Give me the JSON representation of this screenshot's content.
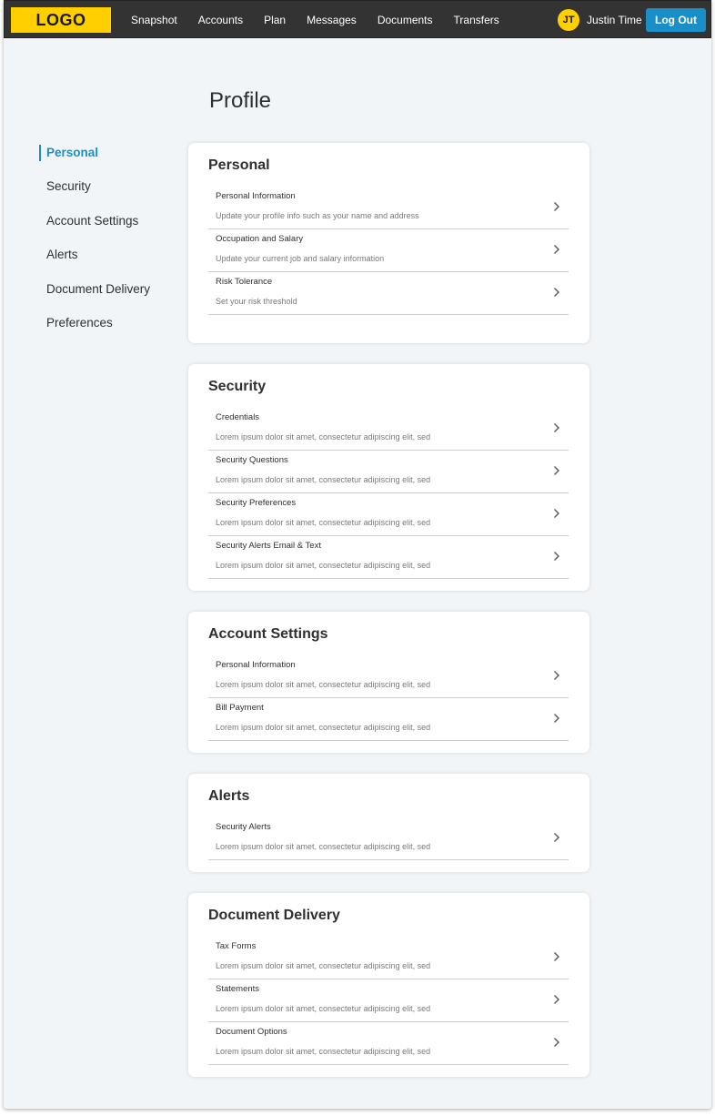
{
  "header": {
    "logo": "LOGO",
    "nav": [
      "Snapshot",
      "Accounts",
      "Plan",
      "Messages",
      "Documents",
      "Transfers"
    ],
    "user_initials": "JT",
    "user_name": "Justin Time",
    "logout_label": "Log Out"
  },
  "page_title": "Profile",
  "sidebar": {
    "items": [
      {
        "label": "Personal",
        "active": true
      },
      {
        "label": "Security"
      },
      {
        "label": "Account Settings"
      },
      {
        "label": "Alerts"
      },
      {
        "label": "Document Delivery"
      },
      {
        "label": "Preferences"
      }
    ]
  },
  "sections": [
    {
      "title": "Personal",
      "rows": [
        {
          "title": "Personal Information",
          "desc": "Update your profile info such as your name and address"
        },
        {
          "title": "Occupation and Salary",
          "desc": "Update your current job and salary information"
        },
        {
          "title": "Risk Tolerance",
          "desc": "Set your risk threshold"
        }
      ]
    },
    {
      "title": "Security",
      "rows": [
        {
          "title": "Credentials",
          "desc": "Lorem ipsum dolor sit amet, consectetur adipiscing elit, sed"
        },
        {
          "title": "Security Questions",
          "desc": "Lorem ipsum dolor sit amet, consectetur adipiscing elit, sed"
        },
        {
          "title": "Security Preferences",
          "desc": "Lorem ipsum dolor sit amet, consectetur adipiscing elit, sed"
        },
        {
          "title": "Security Alerts Email & Text",
          "desc": "Lorem ipsum dolor sit amet, consectetur adipiscing elit, sed"
        }
      ]
    },
    {
      "title": "Account Settings",
      "rows": [
        {
          "title": "Personal Information",
          "desc": "Lorem ipsum dolor sit amet, consectetur adipiscing elit, sed"
        },
        {
          "title": "Bill Payment",
          "desc": "Lorem ipsum dolor sit amet, consectetur adipiscing elit, sed"
        }
      ]
    },
    {
      "title": "Alerts",
      "rows": [
        {
          "title": "Security Alerts",
          "desc": "Lorem ipsum dolor sit amet, consectetur adipiscing elit, sed"
        }
      ]
    },
    {
      "title": "Document Delivery",
      "rows": [
        {
          "title": "Tax Forms",
          "desc": "Lorem ipsum dolor sit amet, consectetur adipiscing elit, sed"
        },
        {
          "title": "Statements",
          "desc": "Lorem ipsum dolor sit amet, consectetur adipiscing elit, sed"
        },
        {
          "title": "Document Options",
          "desc": "Lorem ipsum dolor sit amet, consectetur adipiscing elit, sed"
        }
      ]
    }
  ],
  "colors": {
    "accent": "#1a8fc7",
    "logo": "#ffcf00",
    "topbar": "#333333",
    "background": "#f2f5f8"
  },
  "icons": {
    "row_arrow": "chevron-right-icon"
  }
}
